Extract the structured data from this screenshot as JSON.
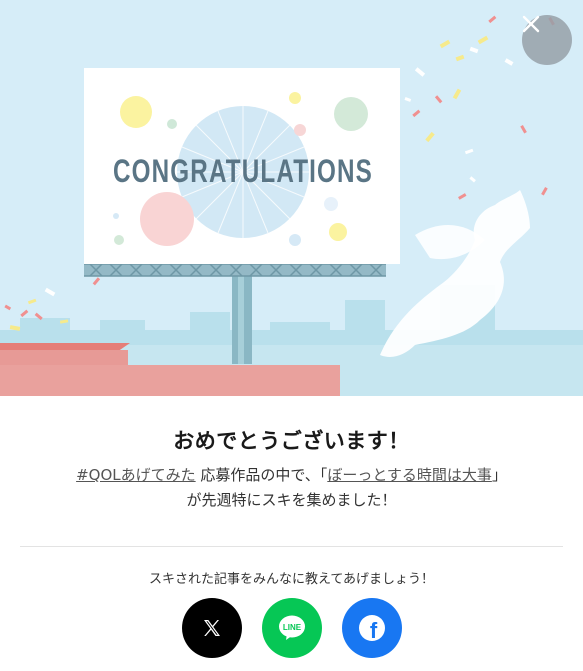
{
  "hero": {
    "billboard_text": "CONGRATULATIONS"
  },
  "dialog": {
    "title": "おめでとうございます！",
    "hashtag_link": "#QOLあげてみた",
    "middle_text": " 応募作品の中で、「",
    "article_link": "ぼーっとする時間は大事",
    "after_link_text": "」",
    "second_line": "が先週特にスキを集めました！",
    "share_prompt": "スキされた記事をみんなに教えてあげましょう！"
  },
  "share": {
    "x_label": "X",
    "line_label": "LINE",
    "facebook_label": "f"
  },
  "colors": {
    "x": "#000000",
    "line": "#06c755",
    "facebook": "#1877f2",
    "sky": "#d6edf8"
  }
}
